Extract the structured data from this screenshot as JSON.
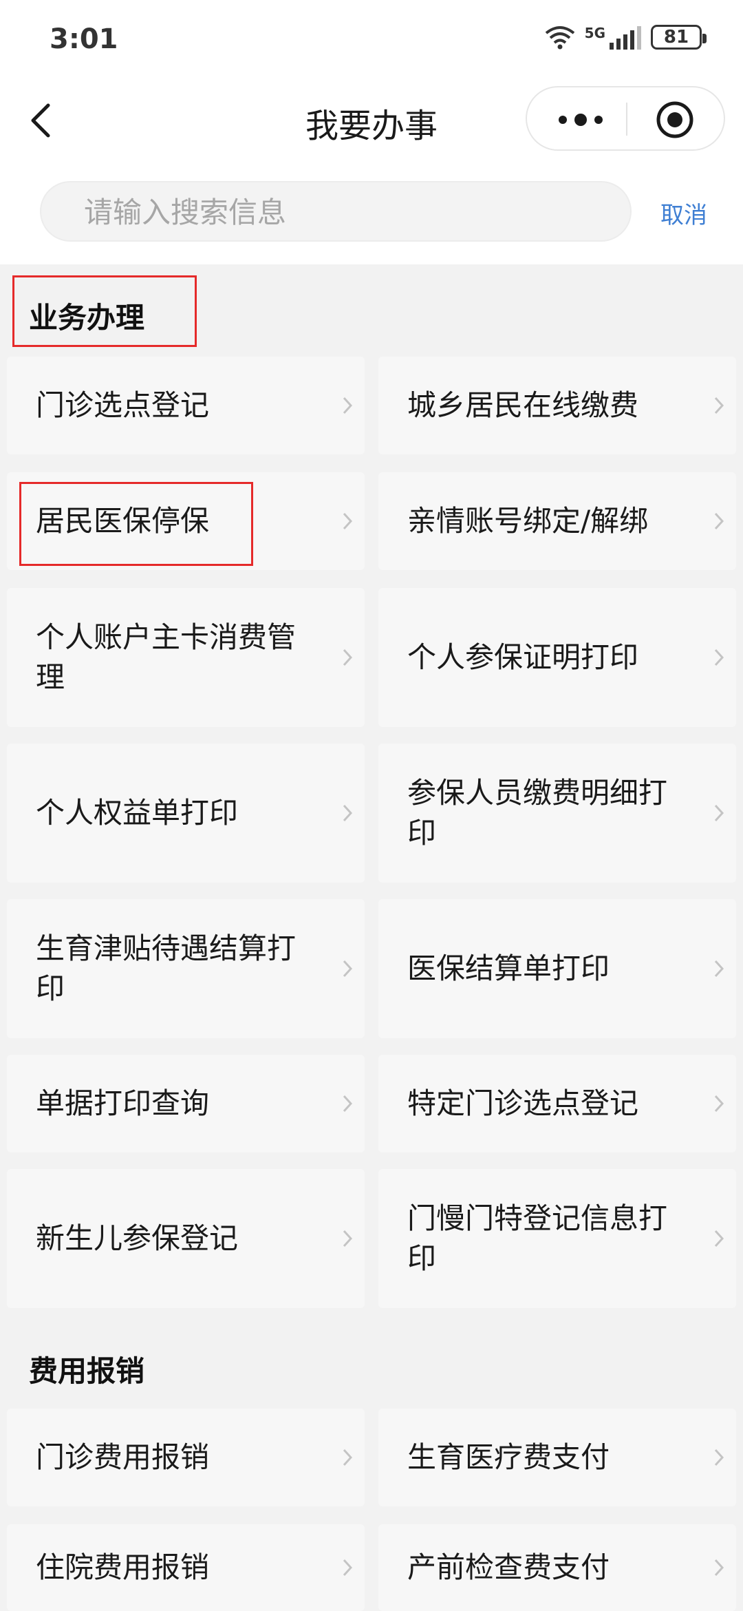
{
  "status": {
    "time": "3:01",
    "network": "5G",
    "battery": "81"
  },
  "nav": {
    "title": "我要办事"
  },
  "search": {
    "placeholder": "请输入搜索信息",
    "value": "",
    "cancel": "取消"
  },
  "sections": [
    {
      "title": "业务办理",
      "items": [
        "门诊选点登记",
        "城乡居民在线缴费",
        "居民医保停保",
        "亲情账号绑定/解绑",
        "个人账户主卡消费管理",
        "个人参保证明打印",
        "个人权益单打印",
        "参保人员缴费明细打印",
        "生育津贴待遇结算打印",
        "医保结算单打印",
        "单据打印查询",
        "特定门诊选点登记",
        "新生儿参保登记",
        "门慢门特登记信息打印"
      ]
    },
    {
      "title": "费用报销",
      "items": [
        "门诊费用报销",
        "生育医疗费支付",
        "住院费用报销",
        "产前检查费支付"
      ]
    }
  ],
  "colors": {
    "highlight": "#e52a2a",
    "cancel": "#3f7fd3",
    "card": "#f7f7f7",
    "background": "#f2f2f2"
  }
}
